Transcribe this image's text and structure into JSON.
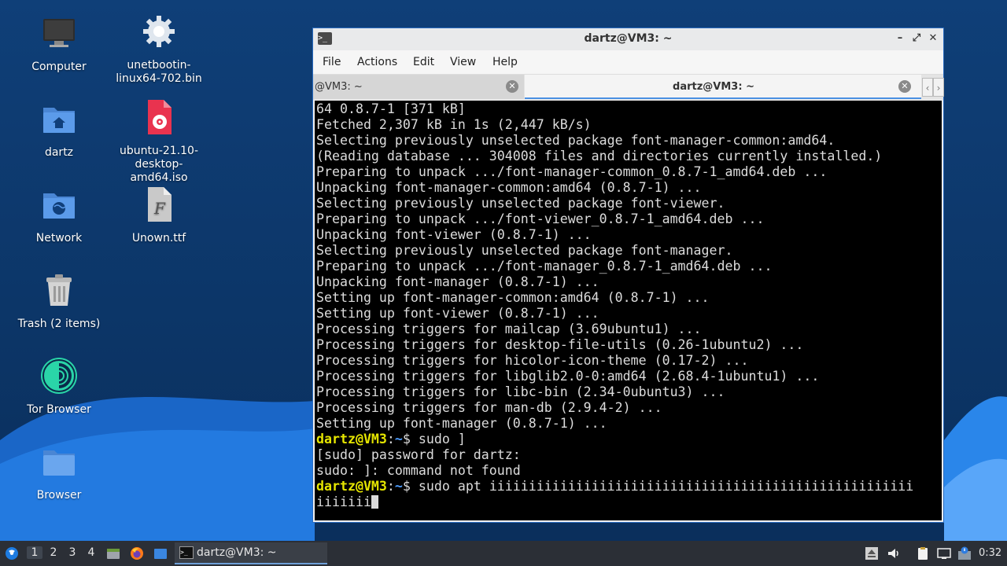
{
  "desktop": {
    "icons": {
      "computer": "Computer",
      "unetbootin": "unetbootin-\nlinux64-702.bin",
      "home": "dartz",
      "ubuntu_iso": "ubuntu-21.10-\ndesktop-\namd64.iso",
      "network": "Network",
      "font_file": "Unown.ttf",
      "trash": "Trash (2 items)",
      "tor": "Tor Browser",
      "browser": "Browser"
    }
  },
  "window": {
    "title": "dartz@VM3: ~",
    "menu": [
      "File",
      "Actions",
      "Edit",
      "View",
      "Help"
    ],
    "tabs": [
      {
        "label": "@VM3: ~",
        "active": false
      },
      {
        "label": "dartz@VM3: ~",
        "active": true
      }
    ],
    "tab_nav": {
      "prev": "‹",
      "next": "›"
    },
    "buttons": {
      "minimize": "–",
      "maximize": "⤢",
      "close": "✕"
    }
  },
  "terminal": {
    "lines": [
      "64 0.8.7-1 [371 kB]",
      "Fetched 2,307 kB in 1s (2,447 kB/s)",
      "Selecting previously unselected package font-manager-common:amd64.",
      "(Reading database ... 304008 files and directories currently installed.)",
      "Preparing to unpack .../font-manager-common_0.8.7-1_amd64.deb ...",
      "Unpacking font-manager-common:amd64 (0.8.7-1) ...",
      "Selecting previously unselected package font-viewer.",
      "Preparing to unpack .../font-viewer_0.8.7-1_amd64.deb ...",
      "Unpacking font-viewer (0.8.7-1) ...",
      "Selecting previously unselected package font-manager.",
      "Preparing to unpack .../font-manager_0.8.7-1_amd64.deb ...",
      "Unpacking font-manager (0.8.7-1) ...",
      "Setting up font-manager-common:amd64 (0.8.7-1) ...",
      "Setting up font-viewer (0.8.7-1) ...",
      "Processing triggers for mailcap (3.69ubuntu1) ...",
      "Processing triggers for desktop-file-utils (0.26-1ubuntu2) ...",
      "Processing triggers for hicolor-icon-theme (0.17-2) ...",
      "Processing triggers for libglib2.0-0:amd64 (2.68.4-1ubuntu1) ...",
      "Processing triggers for libc-bin (2.34-0ubuntu3) ...",
      "Processing triggers for man-db (2.9.4-2) ...",
      "Setting up font-manager (0.8.7-1) ..."
    ],
    "prompt_user": "dartz@VM3",
    "prompt_path": "~",
    "cmd1": "$ sudo ]",
    "sudo_prompt": "[sudo] password for dartz:",
    "error": "sudo: ]: command not found",
    "cmd2": "$ sudo apt iiiiiiiiiiiiiiiiiiiiiiiiiiiiiiiiiiiiiiiiiiiiiiiiiiiiii",
    "cmd2_wrap": "iiiiiii"
  },
  "taskbar": {
    "workspaces": [
      "1",
      "2",
      "3",
      "4"
    ],
    "task_label": "dartz@VM3: ~",
    "clock": "0:32"
  },
  "colors": {
    "wallpaper_dark": "#0d3e75",
    "wallpaper_wave": "#1e6fd0",
    "prompt_user": "#e6e600",
    "prompt_path": "#4d9dff",
    "folder": "#5b9bea"
  }
}
